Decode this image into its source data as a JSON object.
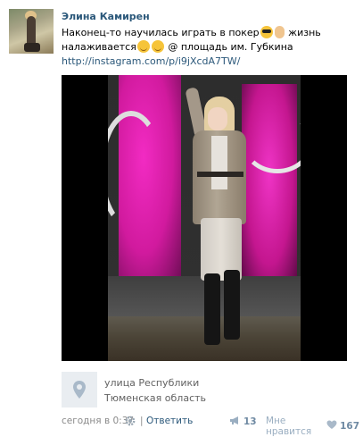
{
  "post": {
    "author": "Элина Камирен",
    "text_line1_a": "Наконец-то научилась играть в покер",
    "text_line1_b": " жизнь",
    "text_line2_a": "налаживается",
    "text_line2_b": " @ площадь им. Губкина",
    "link": "http://instagram.com/p/i9jXcdA7TW/"
  },
  "place": {
    "street": "улица Республики",
    "region": "Тюменская область"
  },
  "footer": {
    "time": "сегодня в 0:37",
    "separator": "|",
    "reply": "Ответить",
    "share_count": "13",
    "like_label": "Мне нравится",
    "like_count": "167"
  },
  "icons": {
    "avatar": "user-avatar",
    "map": "map-pin-icon",
    "gear": "gear-icon",
    "share": "megaphone-icon",
    "like": "heart-icon"
  },
  "colors": {
    "link": "#2b587a",
    "meta": "#8a8a8a",
    "counter": "#6f8aa3"
  }
}
